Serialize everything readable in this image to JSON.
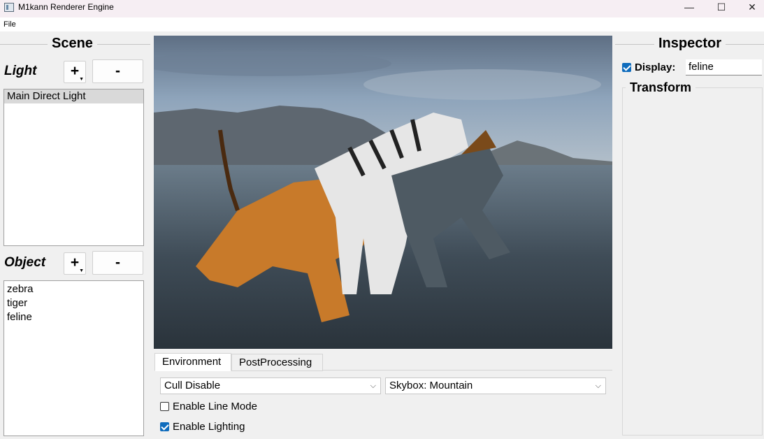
{
  "window": {
    "title": "M1kann Renderer Engine",
    "minimize_glyph": "—",
    "maximize_glyph": "☐",
    "close_glyph": "✕"
  },
  "menu": {
    "file": "File"
  },
  "scene": {
    "heading": "Scene",
    "light": {
      "label": "Light",
      "add": "+",
      "remove": "-",
      "items": [
        "Main Direct Light"
      ]
    },
    "object": {
      "label": "Object",
      "add": "+",
      "remove": "-",
      "items": [
        "zebra",
        "tiger",
        "feline"
      ]
    }
  },
  "tabs": {
    "environment": "Environment",
    "postprocessing": "PostProcessing"
  },
  "environment": {
    "cull": "Cull Disable",
    "skybox": "Skybox: Mountain",
    "line_mode": {
      "label": "Enable Line Mode",
      "checked": false
    },
    "lighting": {
      "label": "Enable Lighting",
      "checked": true
    }
  },
  "inspector": {
    "heading": "Inspector",
    "display_label": "Display:",
    "display_checked": true,
    "name_value": "feline",
    "transform": "Transform"
  },
  "colors": {
    "accent": "#0f6cbd",
    "selection": "#d9d9d9",
    "titlebar": "#f6eef3"
  }
}
